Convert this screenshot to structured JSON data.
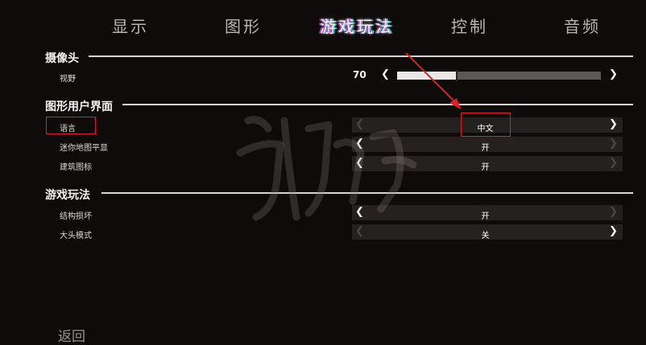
{
  "tabs": [
    {
      "label": "显示",
      "active": false
    },
    {
      "label": "图形",
      "active": false
    },
    {
      "label": "游戏玩法",
      "active": true
    },
    {
      "label": "控制",
      "active": false
    },
    {
      "label": "音频",
      "active": false
    }
  ],
  "camera": {
    "title": "摄像头",
    "fov": {
      "label": "视野",
      "value": "70",
      "slider_fraction": 0.29
    }
  },
  "gui": {
    "title": "图形用户界面",
    "rows": [
      {
        "label": "语言",
        "value": "中文"
      },
      {
        "label": "迷你地图平显",
        "value": "开"
      },
      {
        "label": "建筑图标",
        "value": "开"
      }
    ]
  },
  "gameplay": {
    "title": "游戏玩法",
    "rows": [
      {
        "label": "结构损坏",
        "value": "开"
      },
      {
        "label": "大头模式",
        "value": "关"
      }
    ]
  },
  "back_label": "返回",
  "icons": {
    "left_arrow": "chevron-left-icon",
    "right_arrow": "chevron-right-icon"
  },
  "colors": {
    "background": "#0f0b0b",
    "highlight": "#e02020",
    "tab_active_glow": "#d23bd2"
  }
}
